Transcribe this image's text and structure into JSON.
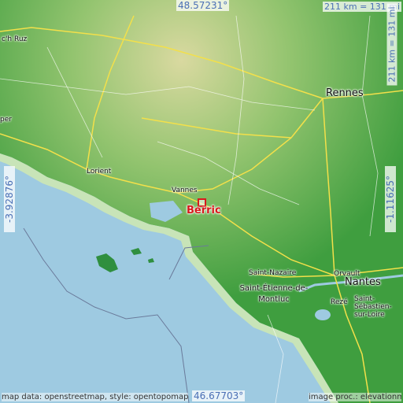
{
  "map": {
    "marker_label": "Berric",
    "coords": {
      "top": "48.57231°",
      "bottom": "46.67703°",
      "left": "-3.92876°",
      "right": "-1.11625°"
    },
    "scale": {
      "top": "211 km = 131 mi",
      "side": "211 km = 131 mi"
    },
    "attribution": "map data: openstreetmap, style: opentopomap",
    "attribution_right": "image proc.: elevationmaps",
    "cities": [
      "Rennes",
      "Lorient",
      "Vannes",
      "Nantes",
      "Saint-Nazaire",
      "Saint-Étienne-de-Montluc",
      "Orvault",
      "Rezé",
      "Saint-Sébastien-sur-Loire",
      "c'h Ruz",
      "per"
    ],
    "colors": {
      "sea": "#9ecae1",
      "land_low": "#3f9e3f",
      "land_high": "#c9c98a",
      "marker": "#d7191c",
      "coord_text": "#4a6fb5"
    }
  }
}
